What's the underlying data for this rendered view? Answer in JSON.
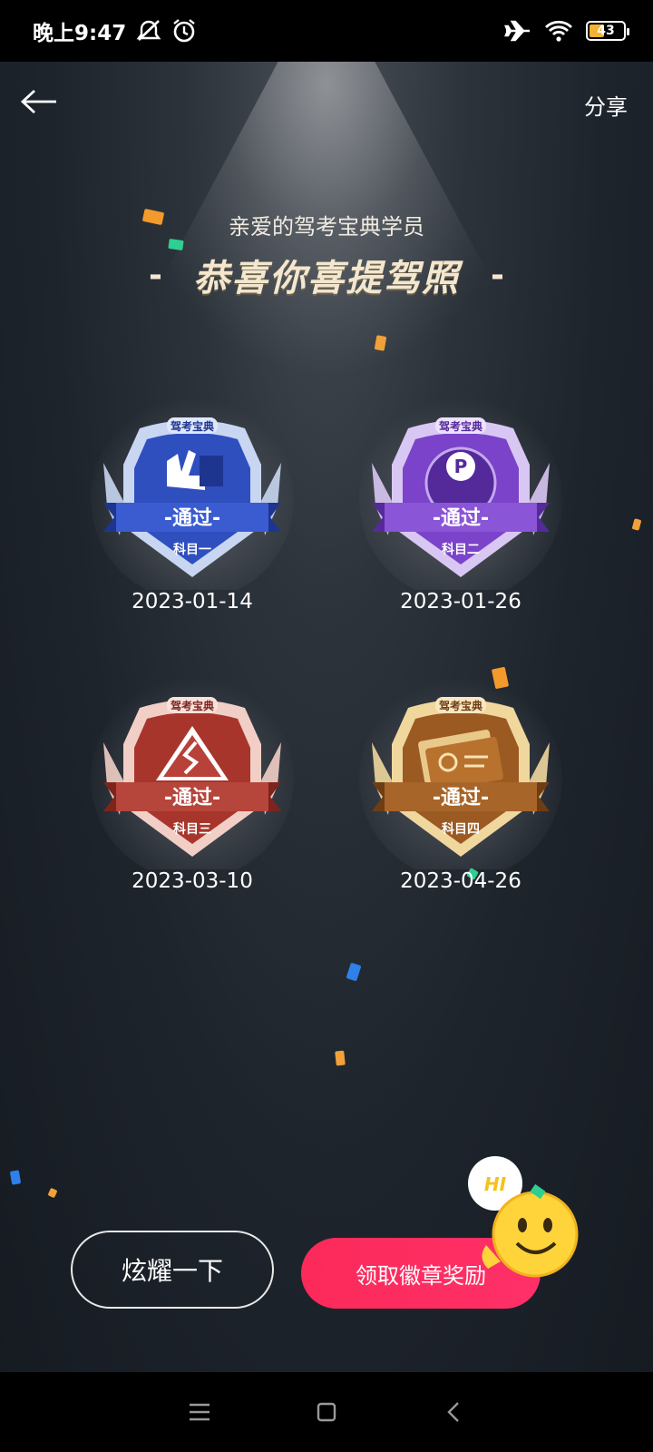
{
  "status_bar": {
    "time": "晚上9:47",
    "battery": "43",
    "icons": [
      "mute-icon",
      "alarm-icon",
      "airplane-icon",
      "wifi-icon",
      "battery-icon"
    ]
  },
  "header": {
    "back_icon": "back-arrow-icon",
    "share_label": "分享"
  },
  "greeting": {
    "subtitle": "亲爱的驾考宝典学员",
    "dash_left": "-",
    "headline": "恭喜你喜提驾照",
    "dash_right": "-"
  },
  "badges": [
    {
      "brand": "驾考宝典",
      "ribbon": "-通过-",
      "subject": "科目一",
      "date": "2023-01-14",
      "theme": "blue",
      "colors": {
        "main": "#2f4fbf",
        "dark": "#1e3590",
        "light": "#c9d6f2"
      }
    },
    {
      "brand": "驾考宝典",
      "ribbon": "-通过-",
      "subject": "科目二",
      "date": "2023-01-26",
      "theme": "purple",
      "colors": {
        "main": "#7a43c9",
        "dark": "#542a9a",
        "light": "#d9c7f3"
      }
    },
    {
      "brand": "驾考宝典",
      "ribbon": "-通过-",
      "subject": "科目三",
      "date": "2023-03-10",
      "theme": "rose",
      "colors": {
        "main": "#a8352c",
        "dark": "#7d241c",
        "light": "#f1cfc6"
      }
    },
    {
      "brand": "驾考宝典",
      "ribbon": "-通过-",
      "subject": "科目四",
      "date": "2023-04-26",
      "theme": "gold",
      "colors": {
        "main": "#9a5a22",
        "dark": "#6e3d13",
        "light": "#f0d79d"
      }
    }
  ],
  "actions": {
    "show_off_label": "炫耀一下",
    "claim_label": "领取徽章奖励",
    "claim_color": "#ff2d62"
  },
  "mascot": {
    "speech": "HI"
  },
  "nav_bar": {
    "icons": [
      "menu-icon",
      "home-icon",
      "back-icon"
    ]
  }
}
